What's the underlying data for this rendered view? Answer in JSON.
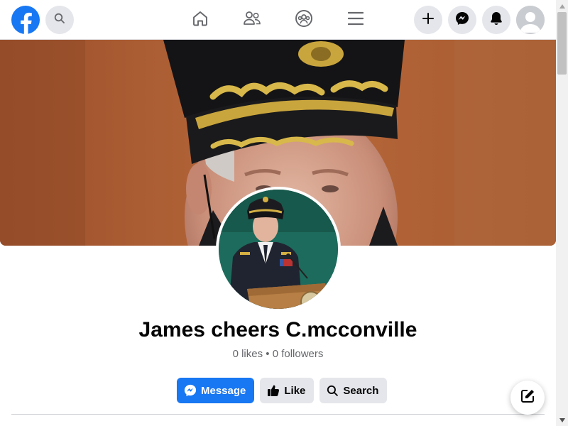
{
  "topbar": {
    "nav": [
      "home-icon",
      "friends-icon",
      "groups-icon",
      "menu-icon"
    ],
    "actions": [
      "plus-icon",
      "messenger-icon",
      "bell-icon"
    ]
  },
  "profile": {
    "name": "James cheers C.mcconville",
    "stats": "0 likes • 0 followers"
  },
  "buttons": {
    "message": "Message",
    "like": "Like",
    "search": "Search"
  },
  "colors": {
    "brand": "#1877f2",
    "button_gray": "#e4e6eb",
    "text_primary": "#050505",
    "text_secondary": "#65676b"
  }
}
